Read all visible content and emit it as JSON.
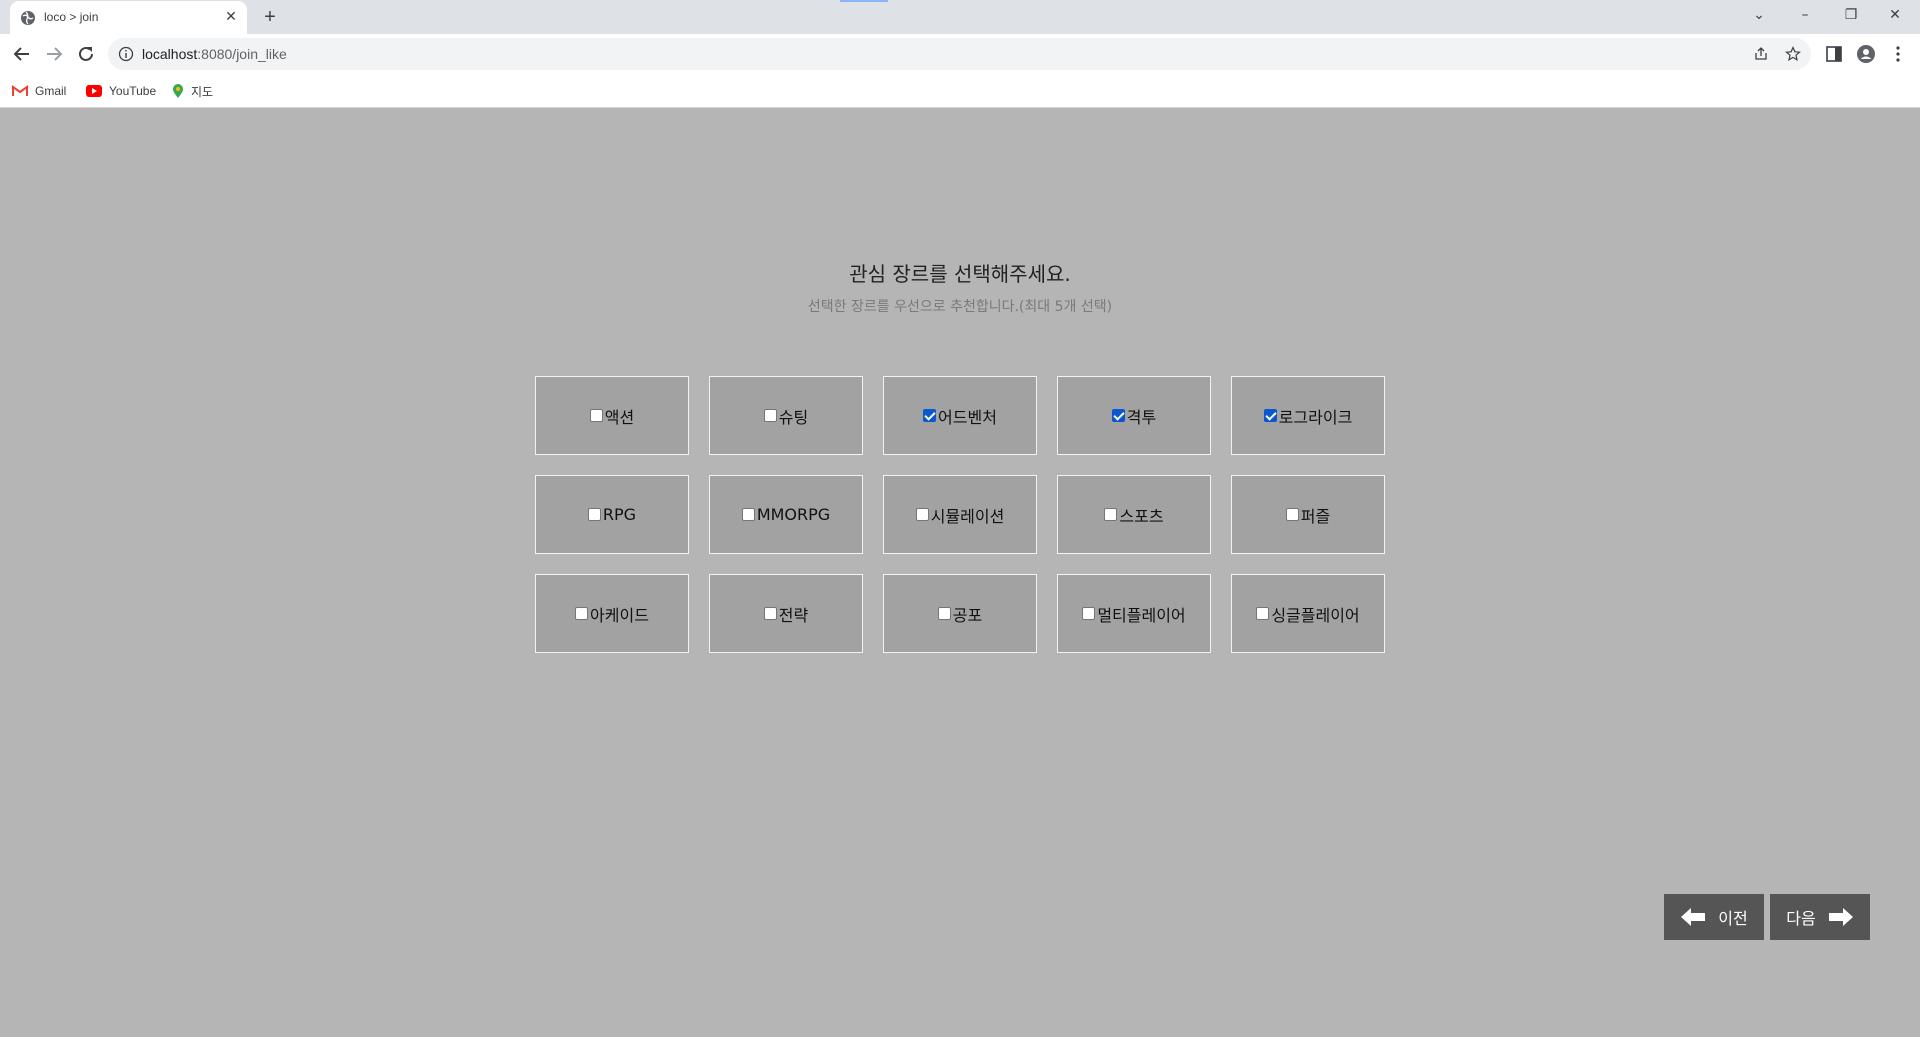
{
  "browser": {
    "tab_title": "loco > join",
    "url_host": "localhost",
    "url_path": ":8080/join_like",
    "bookmarks": [
      {
        "label": "Gmail",
        "icon": "gmail-icon"
      },
      {
        "label": "YouTube",
        "icon": "youtube-icon"
      },
      {
        "label": "지도",
        "icon": "maps-icon"
      }
    ]
  },
  "page": {
    "heading": "관심 장르를 선택해주세요.",
    "subheading": "선택한 장르를 우선으로 추천합니다.(최대 5개 선택)",
    "genres": [
      {
        "label": "액션",
        "checked": false
      },
      {
        "label": "슈팅",
        "checked": false
      },
      {
        "label": "어드벤처",
        "checked": true
      },
      {
        "label": "격투",
        "checked": true
      },
      {
        "label": "로그라이크",
        "checked": true
      },
      {
        "label": "RPG",
        "checked": false
      },
      {
        "label": "MMORPG",
        "checked": false
      },
      {
        "label": "시뮬레이션",
        "checked": false
      },
      {
        "label": "스포츠",
        "checked": false
      },
      {
        "label": "퍼즐",
        "checked": false
      },
      {
        "label": "아케이드",
        "checked": false
      },
      {
        "label": "전략",
        "checked": false
      },
      {
        "label": "공포",
        "checked": false
      },
      {
        "label": "멀티플레이어",
        "checked": false
      },
      {
        "label": "싱글플레이어",
        "checked": false
      }
    ],
    "prev_label": "이전",
    "next_label": "다음"
  },
  "colors": {
    "page_background": "#b5b5b5",
    "genre_box": "#a2a2a2",
    "nav_button": "#555555",
    "checkbox_checked": "#0b57d0"
  }
}
